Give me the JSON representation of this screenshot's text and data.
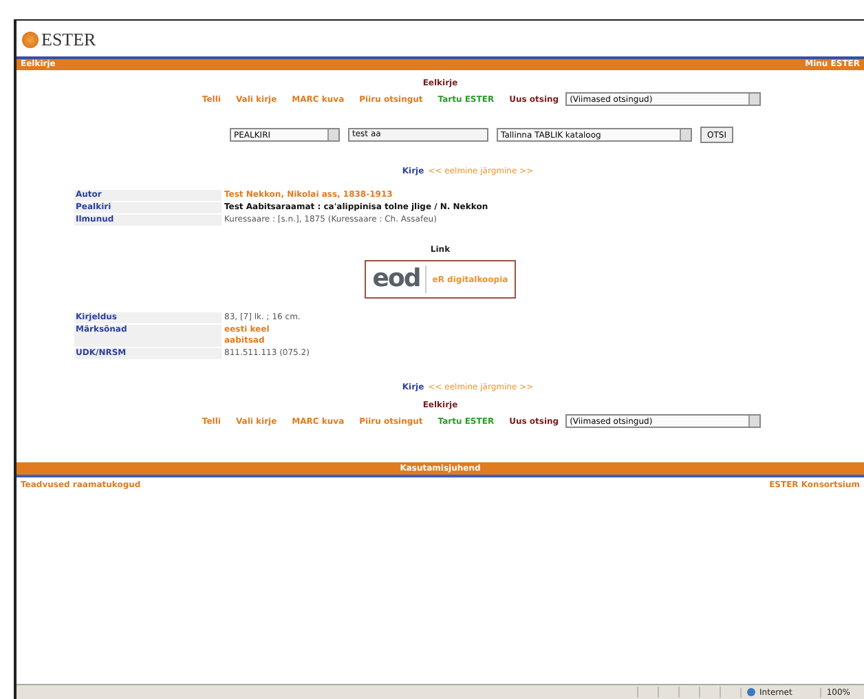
{
  "header": {
    "logo": "ESTER",
    "bar_left": "Eelkirje",
    "bar_right": "Minu ESTER"
  },
  "nav_top": {
    "heading": "Eelkirje",
    "items": [
      {
        "label": "Telli",
        "color": "#e07b20"
      },
      {
        "label": "Vali kirje",
        "color": "#e07b20"
      },
      {
        "label": "MARC kuva",
        "color": "#e07b20"
      },
      {
        "label": "Piiru otsingut",
        "color": "#e07b20"
      },
      {
        "label": "Tartu ESTER",
        "color": "#2a9a2a"
      },
      {
        "label": "Uus otsing",
        "color": "#7a1a1a"
      }
    ],
    "select": "(Viimased otsingud)"
  },
  "search": {
    "field_type": "PEALKIRI",
    "query": "test aa",
    "catalog": "Tallinna TABLIK kataloog",
    "button": "OTSI"
  },
  "record_nav_top": {
    "label": "Kirje",
    "links": "<< eelmine järgmine >>"
  },
  "record": [
    {
      "label": "Autor",
      "values": [
        {
          "text": "Test Nekkon, Nikolai ass, 1838-1913",
          "kind": "link"
        }
      ]
    },
    {
      "label": "Pealkiri",
      "values": [
        {
          "text": "Test Aabitsaraamat : ca'alippinisa tolne jlige / N. Nekkon",
          "kind": "title"
        }
      ]
    },
    {
      "label": "Ilmunud",
      "values": [
        {
          "text": "Kuressaare : [s.n.], 1875 (Kuressaare : Ch. Assafeu)",
          "kind": "text"
        }
      ]
    }
  ],
  "link_section": {
    "heading": "Link",
    "logo": "eod",
    "link": "eR digitalkoopia"
  },
  "record_more": [
    {
      "label": "Kirjeldus",
      "values": [
        {
          "text": "83, [7] lk. ; 16 cm.",
          "kind": "text"
        }
      ]
    },
    {
      "label": "Märksõnad",
      "values": [
        {
          "text": "eesti keel",
          "kind": "link"
        },
        {
          "text": "aabitsad",
          "kind": "link"
        }
      ]
    },
    {
      "label": "UDK/NRSM",
      "values": [
        {
          "text": "811.511.113 (075.2)",
          "kind": "text"
        }
      ]
    }
  ],
  "record_nav_bottom": {
    "label": "Kirje",
    "links": "<< eelmine järgmine >>"
  },
  "nav_bottom": {
    "heading": "Eelkirje",
    "items": [
      {
        "label": "Telli",
        "color": "#e07b20"
      },
      {
        "label": "Vali kirje",
        "color": "#e07b20"
      },
      {
        "label": "MARC kuva",
        "color": "#e07b20"
      },
      {
        "label": "Piiru otsingut",
        "color": "#e07b20"
      },
      {
        "label": "Tartu ESTER",
        "color": "#2a9a2a"
      },
      {
        "label": "Uus otsing",
        "color": "#7a1a1a"
      }
    ],
    "select": "(Viimased otsingud)"
  },
  "footer": {
    "bar": "Kasutamisjuhend",
    "left": "Teadvused raamatukogud",
    "right": "ESTER Konsortsium"
  },
  "status_bar": {
    "zone": "Internet",
    "zoom": "100%"
  }
}
